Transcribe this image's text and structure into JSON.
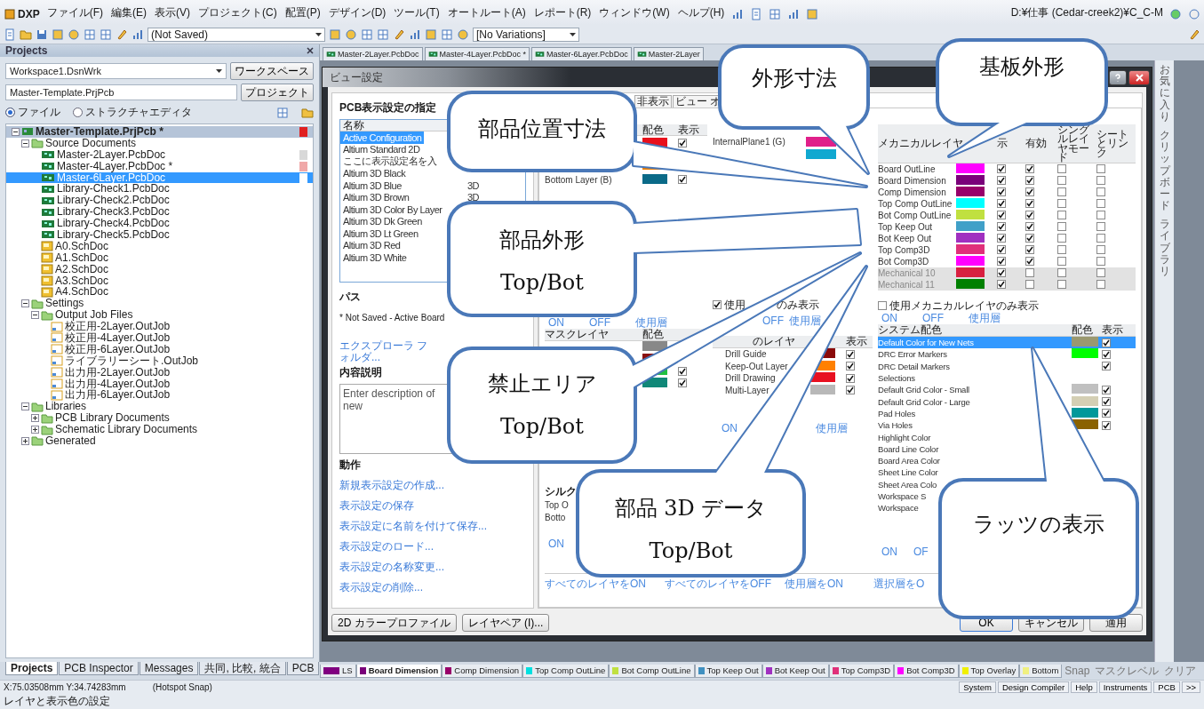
{
  "menu_bar": {
    "logo": "DXP",
    "items": [
      "ファイル(F)",
      "編集(E)",
      "表示(V)",
      "プロジェクト(C)",
      "配置(P)",
      "デザイン(D)",
      "ツール(T)",
      "オートルート(A)",
      "レポート(R)",
      "ウィンドウ(W)",
      "ヘルプ(H)"
    ],
    "path": "D:¥仕事 (Cedar-creek2)¥C_C-M"
  },
  "toolbar": {
    "config_dropdown": "(Not Saved)",
    "variant_dropdown": "[No Variations]"
  },
  "projects_panel": {
    "title": "Projects",
    "workspace": "Workspace1.DsnWrk",
    "workspace_button": "ワークスペース",
    "project": "Master-Template.PrjPcb",
    "project_button": "プロジェクト",
    "view_modes": [
      {
        "label": "ファイル",
        "selected": true
      },
      {
        "label": "ストラクチャエディタ",
        "selected": false
      }
    ],
    "tree": [
      {
        "label": "Master-Template.PrjPcb *",
        "kind": "project",
        "expanded": true,
        "selected": false,
        "color": "#e02020",
        "children": [
          {
            "label": "Source Documents",
            "kind": "folder",
            "expanded": true,
            "selected": false,
            "children": [
              {
                "label": "Master-2Layer.PcbDoc",
                "kind": "pcb",
                "selected": false,
                "color": "#d8d8d8"
              },
              {
                "label": "Master-4Layer.PcbDoc *",
                "kind": "pcb",
                "selected": false,
                "color": "#f0a8a8"
              },
              {
                "label": "Master-6Layer.PcbDoc",
                "kind": "pcb",
                "selected": true,
                "color": "#ffffff"
              },
              {
                "label": "Library-Check1.PcbDoc",
                "kind": "pcb",
                "selected": false
              },
              {
                "label": "Library-Check2.PcbDoc",
                "kind": "pcb",
                "selected": false
              },
              {
                "label": "Library-Check3.PcbDoc",
                "kind": "pcb",
                "selected": false
              },
              {
                "label": "Library-Check4.PcbDoc",
                "kind": "pcb",
                "selected": false
              },
              {
                "label": "Library-Check5.PcbDoc",
                "kind": "pcb",
                "selected": false
              },
              {
                "label": "A0.SchDoc",
                "kind": "sch",
                "selected": false
              },
              {
                "label": "A1.SchDoc",
                "kind": "sch",
                "selected": false
              },
              {
                "label": "A2.SchDoc",
                "kind": "sch",
                "selected": false
              },
              {
                "label": "A3.SchDoc",
                "kind": "sch",
                "selected": false
              },
              {
                "label": "A4.SchDoc",
                "kind": "sch",
                "selected": false
              }
            ]
          },
          {
            "label": "Settings",
            "kind": "folder",
            "expanded": true,
            "selected": false,
            "children": [
              {
                "label": "Output Job Files",
                "kind": "folder",
                "expanded": true,
                "selected": false,
                "children": [
                  {
                    "label": "校正用-2Layer.OutJob",
                    "kind": "outjob",
                    "selected": false
                  },
                  {
                    "label": "校正用-4Layer.OutJob",
                    "kind": "outjob",
                    "selected": false
                  },
                  {
                    "label": "校正用-6Layer.OutJob",
                    "kind": "outjob",
                    "selected": false
                  },
                  {
                    "label": "ライブラリーシート.OutJob",
                    "kind": "outjob",
                    "selected": false
                  },
                  {
                    "label": "出力用-2Layer.OutJob",
                    "kind": "outjob",
                    "selected": false
                  },
                  {
                    "label": "出力用-4Layer.OutJob",
                    "kind": "outjob",
                    "selected": false
                  },
                  {
                    "label": "出力用-6Layer.OutJob",
                    "kind": "outjob",
                    "selected": false
                  }
                ]
              }
            ]
          },
          {
            "label": "Libraries",
            "kind": "folder",
            "expanded": true,
            "selected": false,
            "children": [
              {
                "label": "PCB Library Documents",
                "kind": "folder",
                "expanded": false,
                "selected": false
              },
              {
                "label": "Schematic Library Documents",
                "kind": "folder",
                "expanded": false,
                "selected": false
              }
            ]
          },
          {
            "label": "Generated",
            "kind": "folder",
            "expanded": false,
            "selected": false
          }
        ]
      }
    ],
    "tabs": [
      {
        "label": "Projects",
        "selected": true
      },
      {
        "label": "PCB Inspector",
        "selected": false
      },
      {
        "label": "Messages",
        "selected": false
      },
      {
        "label": "共同, 比較, 統合",
        "selected": false
      },
      {
        "label": "PCB",
        "selected": false
      }
    ]
  },
  "document_tabs": [
    {
      "label": "Master-2Layer.PcbDoc",
      "selected": false
    },
    {
      "label": "Master-4Layer.PcbDoc *",
      "selected": false
    },
    {
      "label": "Master-6Layer.PcbDoc",
      "selected": false
    },
    {
      "label": "Master-2Layer",
      "selected": false
    }
  ],
  "side_strip": [
    "お気に入り",
    "クリップボード",
    "ライブラリ"
  ],
  "dialog": {
    "title": "ビュー設定",
    "config_heading": "PCB表示設定の指定",
    "config_column": "名称",
    "configs": [
      {
        "name": "Active Configuration",
        "selected": true
      },
      {
        "name": "Altium Standard 2D",
        "selected": false
      },
      {
        "name": "ここに表示設定名を入",
        "selected": false
      },
      {
        "name": "Altium 3D Black",
        "selected": false
      },
      {
        "name": "Altium 3D Blue",
        "type": "3D",
        "selected": false
      },
      {
        "name": "Altium 3D Brown",
        "type": "3D",
        "selected": false
      },
      {
        "name": "Altium 3D Color By Layer",
        "selected": false
      },
      {
        "name": "Altium 3D Dk Green",
        "selected": false
      },
      {
        "name": "Altium 3D Lt Green",
        "selected": false
      },
      {
        "name": "Altium 3D Red",
        "selected": false
      },
      {
        "name": "Altium 3D White",
        "selected": false
      }
    ],
    "path_label": "パス",
    "path_value": "* Not Saved - Active Board",
    "explorer_link": "エクスプローラ フォルダ...",
    "description_label": "内容説明",
    "description_placeholder": "Enter description of new",
    "actions_label": "動作",
    "actions": [
      "新規表示設定の作成...",
      "表示設定の保存",
      "表示設定に名前を付けて保存...",
      "表示設定のロード...",
      "表示設定の名称変更...",
      "表示設定の削除..."
    ],
    "right_tabs": [
      "非表示",
      "ビュー オ"
    ],
    "signal_header": [
      "配色",
      "表示"
    ],
    "signal_layers": [
      {
        "color": "#e8101c",
        "shown": true
      },
      {
        "color": "#f08000"
      },
      {
        "name": "Bottom Layer (B)",
        "color": "#0a6a88",
        "shown": true
      }
    ],
    "plane_layers": [
      {
        "name": "InternalPlane1 (G)",
        "color": "#e0208a"
      },
      {
        "color": "#10a8d0"
      }
    ],
    "plane_only": {
      "label_start": "使用",
      "label_end": "のみ表示",
      "checked": true
    },
    "signal_switch": [
      "ON",
      "OFF",
      "使用層"
    ],
    "plane_switch": [
      "OFF",
      "使用層"
    ],
    "mask_header": [
      "マスクレイヤ",
      "配色"
    ],
    "mask_layers": [
      {
        "color": "#888888"
      },
      {
        "color": "#8a1010"
      },
      {
        "color": "#20c040",
        "shown": true
      },
      {
        "color": "#108878",
        "shown": true
      }
    ],
    "other_header": [
      "のレイヤ",
      "表示"
    ],
    "other_layers": [
      {
        "name": "Drill Guide",
        "color": "#8a0a0a",
        "shown": true
      },
      {
        "name": "Keep-Out Layer",
        "color": "#ff8000",
        "shown": true
      },
      {
        "name": "Drill Drawing",
        "color": "#e81020",
        "shown": true
      },
      {
        "name": "Multi-Layer",
        "color": "#b8b8b8",
        "shown": true
      }
    ],
    "other_switch": [
      "ON",
      "使用層"
    ],
    "silk_header": "シルク",
    "silk_rows": [
      "Top O",
      "Botto"
    ],
    "silk_switch": "ON",
    "mech_header": [
      "メカニカルレイヤ",
      "示",
      "有効",
      "シングルレイヤモード",
      "シートとリンク"
    ],
    "mech_layers": [
      {
        "name": "Board OutLine",
        "color": "#ff00ff",
        "shown": true,
        "enabled": true,
        "single": false,
        "linked": false
      },
      {
        "name": "Board Dimension",
        "color": "#7a007a",
        "shown": true,
        "enabled": true,
        "single": false,
        "linked": false
      },
      {
        "name": "Comp Dimension",
        "color": "#98006a",
        "shown": true,
        "enabled": true,
        "single": false,
        "linked": false
      },
      {
        "name": "Top Comp OutLine",
        "color": "#00ffff",
        "shown": true,
        "enabled": true,
        "single": false,
        "linked": false
      },
      {
        "name": "Bot Comp OutLine",
        "color": "#c0e040",
        "shown": true,
        "enabled": true,
        "single": false,
        "linked": false
      },
      {
        "name": "Top Keep Out",
        "color": "#40a0c8",
        "shown": true,
        "enabled": true,
        "single": false,
        "linked": false
      },
      {
        "name": "Bot Keep Out",
        "color": "#a030c0",
        "shown": true,
        "enabled": true,
        "single": false,
        "linked": false
      },
      {
        "name": "Top Comp3D",
        "color": "#e0307a",
        "shown": true,
        "enabled": true,
        "single": false,
        "linked": false
      },
      {
        "name": "Bot Comp3D",
        "color": "#ff00ff",
        "shown": true,
        "enabled": true,
        "single": false,
        "linked": false
      },
      {
        "name": "Mechanical 10",
        "color": "#d82040",
        "shown": true,
        "enabled": false,
        "single": false,
        "linked": false
      },
      {
        "name": "Mechanical 11",
        "color": "#008000",
        "shown": true,
        "enabled": false,
        "single": false,
        "linked": false
      }
    ],
    "mech_only": {
      "label": "使用メカニカルレイヤのみ表示",
      "checked": false
    },
    "mech_switch": [
      "ON",
      "OFF",
      "使用層"
    ],
    "system_header": [
      "システム配色",
      "配色",
      "表示"
    ],
    "system_colors": [
      {
        "name": "Default Color for New Nets",
        "color": "#9a9870",
        "shown": true,
        "selected": true
      },
      {
        "name": "DRC Error Markers",
        "color": "#00ff00",
        "shown": true,
        "selected": false
      },
      {
        "name": "DRC Detail Markers",
        "shown": true,
        "selected": false
      },
      {
        "name": "Selections",
        "selected": false
      },
      {
        "name": "Default Grid Color - Small",
        "color": "#c0c0c0",
        "shown": true,
        "selected": false
      },
      {
        "name": "Default Grid Color - Large",
        "color": "#d4cfb4",
        "shown": true,
        "selected": false
      },
      {
        "name": "Pad Holes",
        "color": "#00989a",
        "shown": true,
        "selected": false
      },
      {
        "name": "Via Holes",
        "color": "#8a6200",
        "shown": true,
        "selected": false
      },
      {
        "name": "Highlight Color",
        "selected": false
      },
      {
        "name": "Board Line Color",
        "selected": false
      },
      {
        "name": "Board Area Color",
        "selected": false
      },
      {
        "name": "Sheet Line Color",
        "selected": false
      },
      {
        "name": "Sheet Area Colo",
        "selected": false
      },
      {
        "name": "Workspace S",
        "selected": false
      },
      {
        "name": "Workspace",
        "selected": false
      }
    ],
    "system_switch": [
      "ON",
      "OF"
    ],
    "bulk_links": [
      "すべてのレイヤをON",
      "すべてのレイヤをOFF",
      "使用層をON",
      "選択層をO"
    ],
    "left_buttons": [
      "2D カラープロファイル",
      "レイヤペア (I)..."
    ],
    "buttons": [
      "OK",
      "キャンセル",
      "適用"
    ]
  },
  "layer_tabs": [
    {
      "label": "LS",
      "color": "#800080",
      "selected": false
    },
    {
      "label": "Board Dimension",
      "color": "#7a007a",
      "selected": true
    },
    {
      "label": "Comp Dimension",
      "color": "#98006a",
      "selected": false
    },
    {
      "label": "Top Comp OutLine",
      "color": "#00e0e0",
      "selected": false
    },
    {
      "label": "Bot Comp OutLine",
      "color": "#c0e040",
      "selected": false
    },
    {
      "label": "Top Keep Out",
      "color": "#4090c0",
      "selected": false
    },
    {
      "label": "Bot Keep Out",
      "color": "#a030c0",
      "selected": false
    },
    {
      "label": "Top Comp3D",
      "color": "#e0307a",
      "selected": false
    },
    {
      "label": "Bot Comp3D",
      "color": "#ff00ff",
      "selected": false
    },
    {
      "label": "Top Overlay",
      "color": "#f0f000",
      "selected": false
    },
    {
      "label": "Bottom",
      "color": "#f0f080",
      "selected": false
    }
  ],
  "layer_bar_controls": [
    "Snap",
    "マスクレベル",
    "クリア"
  ],
  "status_bar": {
    "coords": "X:75.03508mm Y:34.74283mm",
    "snap": "(Hotspot Snap)",
    "panels": [
      "System",
      "Design Compiler",
      "Help",
      "Instruments",
      "PCB",
      ">>"
    ],
    "hint": "レイヤと表示色の設定"
  },
  "callouts": [
    {
      "lines": [
        "外形寸法"
      ]
    },
    {
      "lines": [
        "基板外形"
      ]
    },
    {
      "lines": [
        "部品位置寸法"
      ]
    },
    {
      "lines": [
        "部品外形",
        "Top/Bot"
      ]
    },
    {
      "lines": [
        "禁止エリア",
        "Top/Bot"
      ]
    },
    {
      "lines": [
        "部品 3D データ",
        "Top/Bot"
      ]
    },
    {
      "lines": [
        "ラッツの表示"
      ]
    }
  ]
}
